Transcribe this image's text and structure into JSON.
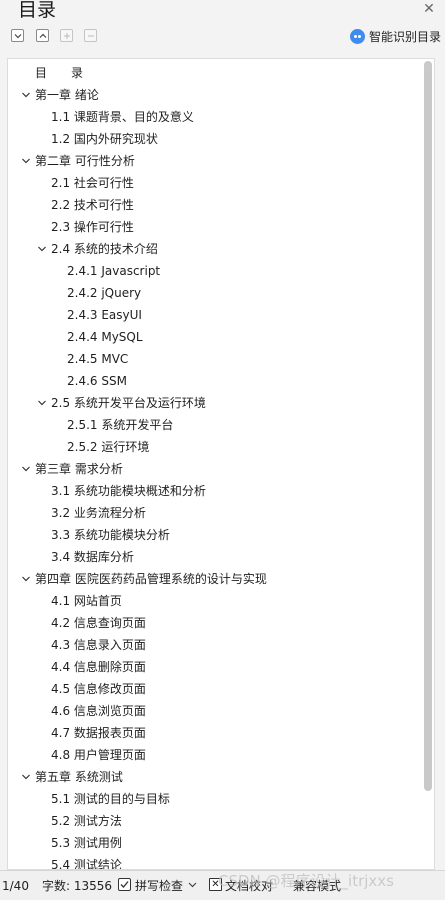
{
  "panel": {
    "title": "目录",
    "smart_recognize_label": "智能识别目录"
  },
  "toc": [
    {
      "text": "目　　录",
      "level": 0,
      "chevron": false
    },
    {
      "text": "第一章  绪论",
      "level": 0,
      "chevron": true
    },
    {
      "text": "1.1  课题背景、目的及意义",
      "level": 1,
      "chevron": false
    },
    {
      "text": "1.2  国内外研究现状",
      "level": 1,
      "chevron": false
    },
    {
      "text": "第二章  可行性分析",
      "level": 0,
      "chevron": true
    },
    {
      "text": "2.1  社会可行性",
      "level": 1,
      "chevron": false
    },
    {
      "text": "2.2  技术可行性",
      "level": 1,
      "chevron": false
    },
    {
      "text": "2.3  操作可行性",
      "level": 1,
      "chevron": false
    },
    {
      "text": "2.4  系统的技术介绍",
      "level": 1,
      "chevron": true
    },
    {
      "text": "2.4.1 Javascript",
      "level": 2,
      "chevron": false
    },
    {
      "text": "2.4.2 jQuery",
      "level": 2,
      "chevron": false
    },
    {
      "text": "2.4.3 EasyUI",
      "level": 2,
      "chevron": false
    },
    {
      "text": "2.4.4 MySQL",
      "level": 2,
      "chevron": false
    },
    {
      "text": "2.4.5 MVC",
      "level": 2,
      "chevron": false
    },
    {
      "text": "2.4.6 SSM",
      "level": 2,
      "chevron": false
    },
    {
      "text": "2.5  系统开发平台及运行环境",
      "level": 1,
      "chevron": true
    },
    {
      "text": "2.5.1  系统开发平台",
      "level": 2,
      "chevron": false
    },
    {
      "text": "2.5.2  运行环境",
      "level": 2,
      "chevron": false
    },
    {
      "text": "第三章  需求分析",
      "level": 0,
      "chevron": true
    },
    {
      "text": "3.1  系统功能模块概述和分析",
      "level": 1,
      "chevron": false
    },
    {
      "text": "3.2  业务流程分析",
      "level": 1,
      "chevron": false
    },
    {
      "text": "3.3  系统功能模块分析",
      "level": 1,
      "chevron": false
    },
    {
      "text": "3.4  数据库分析",
      "level": 1,
      "chevron": false
    },
    {
      "text": "第四章  医院医药药品管理系统的设计与实现",
      "level": 0,
      "chevron": true
    },
    {
      "text": "4.1    网站首页",
      "level": 1,
      "chevron": false
    },
    {
      "text": "4.2    信息查询页面",
      "level": 1,
      "chevron": false
    },
    {
      "text": "4.3    信息录入页面",
      "level": 1,
      "chevron": false
    },
    {
      "text": "4.4    信息删除页面",
      "level": 1,
      "chevron": false
    },
    {
      "text": "4.5    信息修改页面",
      "level": 1,
      "chevron": false
    },
    {
      "text": "4.6    信息浏览页面",
      "level": 1,
      "chevron": false
    },
    {
      "text": "4.7    数据报表页面",
      "level": 1,
      "chevron": false
    },
    {
      "text": "4.8  用户管理页面",
      "level": 1,
      "chevron": false
    },
    {
      "text": "第五章  系统测试",
      "level": 0,
      "chevron": true
    },
    {
      "text": "5.1  测试的目的与目标",
      "level": 1,
      "chevron": false
    },
    {
      "text": "5.2  测试方法",
      "level": 1,
      "chevron": false
    },
    {
      "text": "5.3  测试用例",
      "level": 1,
      "chevron": false
    },
    {
      "text": "5.4  测试结论",
      "level": 1,
      "chevron": false
    }
  ],
  "status_bar": {
    "page": "1/40",
    "word_count": "字数: 13556",
    "spell_check": "拼写检查",
    "doc_proofread": "文档校对",
    "compat_mode": "兼容模式"
  },
  "watermark": "CSDN @程序设计_itrjxxs"
}
